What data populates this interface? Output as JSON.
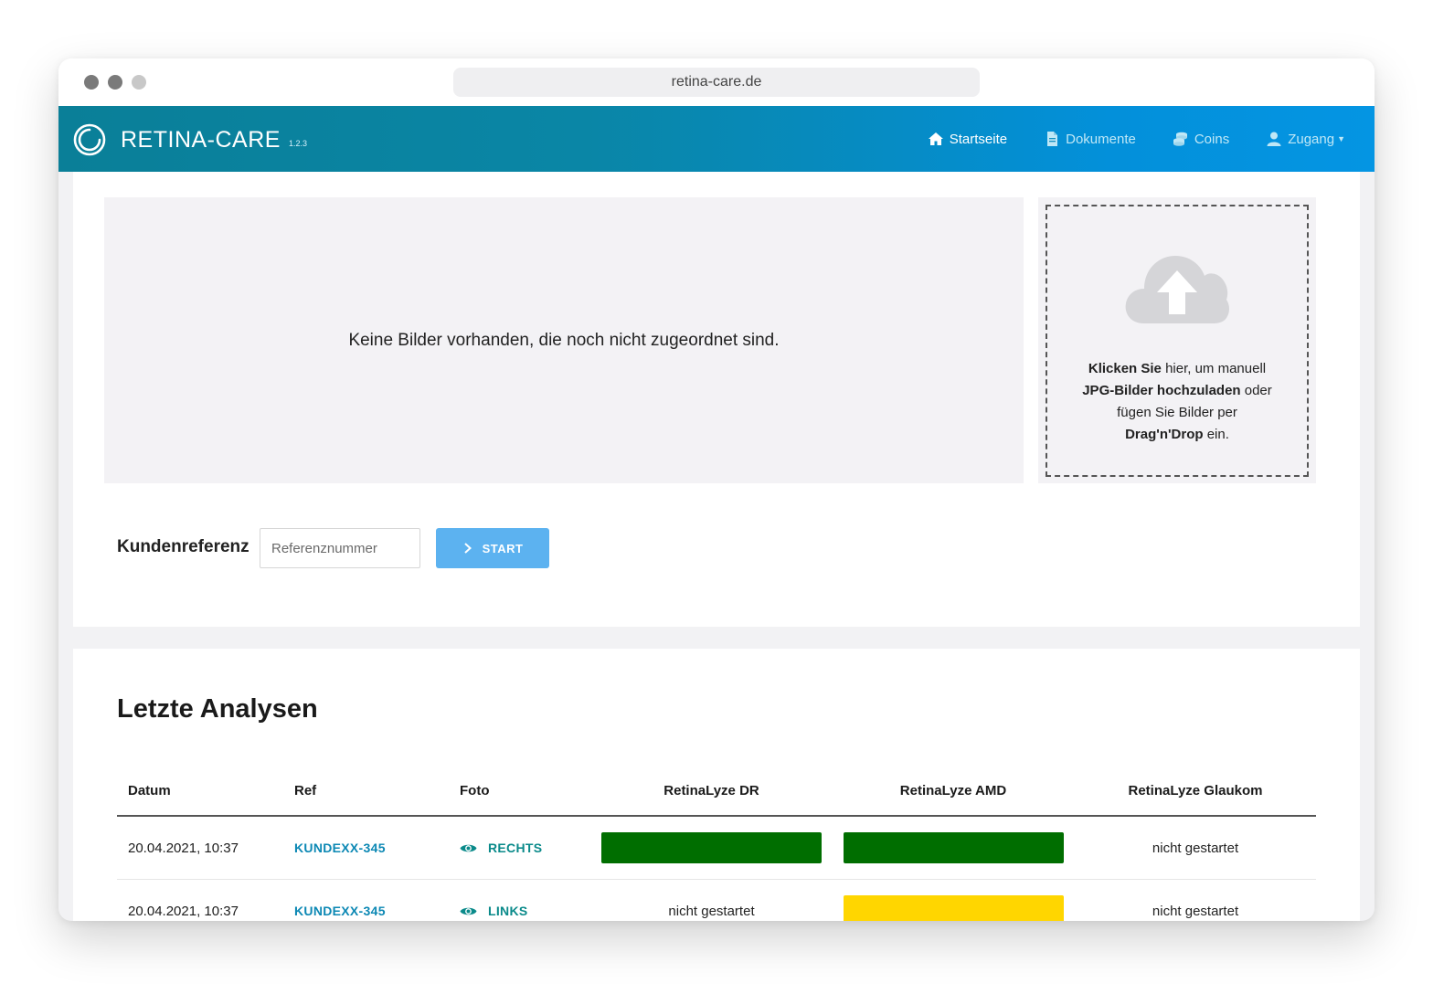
{
  "browser": {
    "url": "retina-care.de"
  },
  "brand": {
    "name": "RETINA-CARE",
    "version": "1.2.3"
  },
  "nav": {
    "items": [
      {
        "label": "Startseite",
        "icon": "home-icon"
      },
      {
        "label": "Dokumente",
        "icon": "document-icon"
      },
      {
        "label": "Coins",
        "icon": "coins-icon"
      },
      {
        "label": "Zugang",
        "icon": "user-icon"
      }
    ]
  },
  "images": {
    "empty_message": "Keine Bilder vorhanden, die noch nicht zugeordnet sind."
  },
  "upload": {
    "line1_bold": "Klicken Sie",
    "line1_rest": " hier, um manuell",
    "line2_bold": "JPG-Bilder hochzuladen",
    "line2_rest": " oder",
    "line3": "fügen Sie Bilder per",
    "line4_bold": "Drag'n'Drop",
    "line4_rest": " ein."
  },
  "reference": {
    "label": "Kundenreferenz",
    "placeholder": "Referenznummer",
    "value": "",
    "button": "START"
  },
  "analyses": {
    "title": "Letzte Analysen",
    "columns": [
      "Datum",
      "Ref",
      "Foto",
      "RetinaLyze DR",
      "RetinaLyze AMD",
      "RetinaLyze Glaukom"
    ],
    "rows": [
      {
        "date": "20.04.2021, 10:37",
        "ref": "KUNDEXX-345",
        "foto": "RECHTS",
        "dr": "",
        "amd": "",
        "glaukom": "nicht gestartet"
      },
      {
        "date": "20.04.2021, 10:37",
        "ref": "KUNDEXX-345",
        "foto": "LINKS",
        "dr": "nicht gestartet",
        "amd": "",
        "glaukom": "nicht gestartet"
      }
    ]
  },
  "colors": {
    "nav_gradient_start": "#0a7f98",
    "nav_gradient_end": "#0495e3",
    "start_button": "#5cb2f0",
    "result_green": "#006e00",
    "result_yellow": "#ffd600",
    "ref_link": "#0c88b4",
    "foto_link": "#0a8a8a"
  }
}
